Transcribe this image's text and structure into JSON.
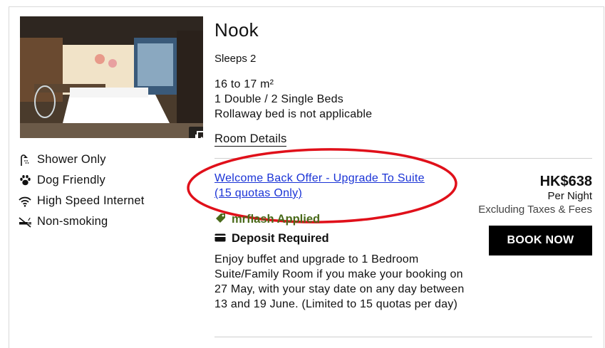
{
  "room": {
    "name": "Nook",
    "sleeps": "Sleeps 2",
    "size": "16 to 17 m²",
    "beds": "1 Double / 2 Single Beds",
    "rollaway": "Rollaway bed is not applicable",
    "details_link": "Room Details"
  },
  "amenities": [
    {
      "icon": "shower-icon",
      "label": "Shower Only"
    },
    {
      "icon": "paw-icon",
      "label": "Dog Friendly"
    },
    {
      "icon": "wifi-icon",
      "label": "High Speed Internet"
    },
    {
      "icon": "no-smoking-icon",
      "label": "Non-smoking"
    }
  ],
  "offer": {
    "title": "Welcome Back Offer - Upgrade To Suite (15 quotas Only)",
    "promo_code": "mrflash Applied",
    "deposit": "Deposit Required",
    "description": "Enjoy buffet and upgrade to 1 Bedroom Suite/Family Room if you make your booking on 27 May, with your stay date on any day between 13 and 19 June. (Limited to 15 quotas per day)",
    "price": "HK$638",
    "per": "Per Night",
    "tax_note": "Excluding Taxes & Fees",
    "book_label": "BOOK NOW"
  },
  "colors": {
    "link": "#1a33d6",
    "promo": "#4a6a1a",
    "annotation": "#e0101a",
    "button_bg": "#000000"
  }
}
